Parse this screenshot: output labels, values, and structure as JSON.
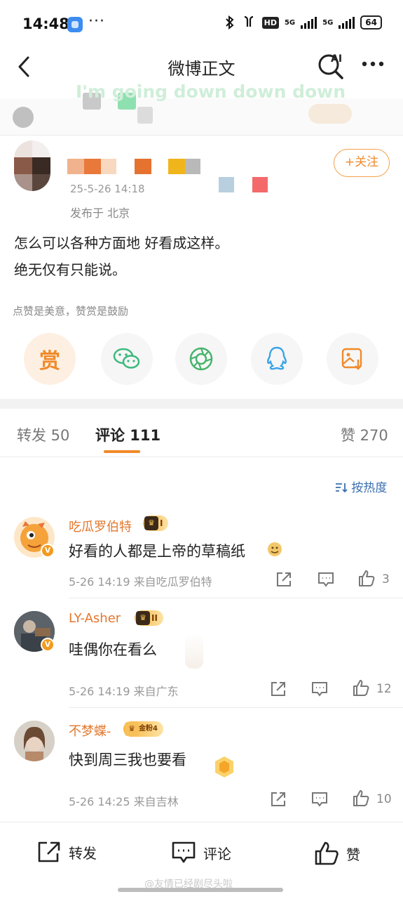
{
  "status_bar": {
    "time": "14:48",
    "dots": "···",
    "hd_label": "HD",
    "net_1": "5G",
    "net_2": "5G",
    "battery": "64"
  },
  "header": {
    "title": "微博正文",
    "ai_label": "AI"
  },
  "overlay": {
    "lyric": "I'm going down down down"
  },
  "post": {
    "time": "25-5-26 14:18",
    "location": "发布于 北京",
    "follow_label": "+关注",
    "text_line_1": "怎么可以各种方面地 好看成这样。",
    "text_line_2": "绝无仅有只能说。",
    "reward_note": "点赞是美意，赞赏是鼓励",
    "reward_label": "赏"
  },
  "tabs": {
    "repost": "转发 50",
    "comment": "评论 111",
    "like": "赞 270"
  },
  "sort_label": "按热度",
  "comments": [
    {
      "name": "吃瓜罗伯特",
      "badge": "I",
      "text": "好看的人都是上帝的草稿纸",
      "meta": "5-26 14:19  来自吃瓜罗伯特",
      "likes": "3"
    },
    {
      "name": "LY-Asher",
      "badge": "II",
      "text": "哇偶你在看么",
      "meta": "5-26 14:19  来自广东",
      "likes": "12"
    },
    {
      "name": "不梦蝶-",
      "badge": "金粉4",
      "text": "快到周三我也要看",
      "meta": "5-26 14:25  来自吉林",
      "likes": "10"
    }
  ],
  "bottom_bar": {
    "repost": "转发",
    "comment": "评论",
    "like": "赞"
  },
  "watermark": "@友情已经剧尽头啦",
  "colors": {
    "accent_orange": "#f08a2a",
    "link_blue": "#3a6fb0",
    "name_orange": "#e2772c"
  }
}
